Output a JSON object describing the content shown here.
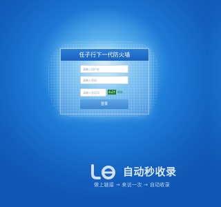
{
  "login": {
    "title": "任子行下一代防火墙",
    "username_placeholder": "请输入用户名",
    "password_placeholder": "请输入密码",
    "captcha_placeholder": "请输入验证码",
    "captcha_code": "4x2f",
    "refresh_label": "刷新",
    "submit_label": "登录"
  },
  "watermark": {
    "title": "自动秒收录",
    "subtitle": "做上链接 → 来访一次 → 自动收录"
  },
  "colors": {
    "background": "#1f7dd8",
    "header": "#1b63bf",
    "button": "#4a91d8",
    "captcha_bg": "#1e7a2f"
  },
  "icons": {
    "watermark_logo": "logo-mark"
  }
}
